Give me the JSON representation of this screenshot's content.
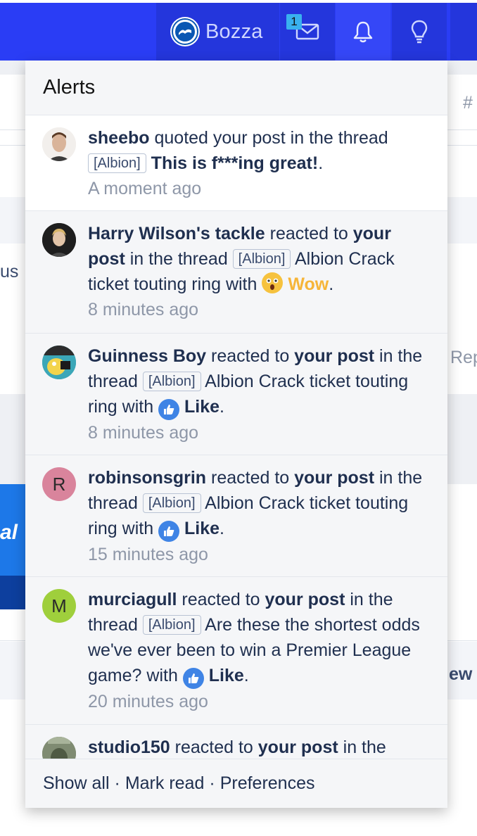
{
  "nav": {
    "username": "Bozza",
    "inbox_badge": "1"
  },
  "background": {
    "hash": "#",
    "us": "us",
    "rep": "Rep",
    "al": "al",
    "ew": "ew"
  },
  "alerts_panel": {
    "title": "Alerts",
    "items": [
      {
        "user": "sheebo",
        "action": " quoted your post in the thread ",
        "prefix": "[Albion]",
        "thread": "This is f***ing great!",
        "time": "A moment ago",
        "avatar_icon": "user-photo"
      },
      {
        "user": "Harry Wilson's tackle",
        "action1": " reacted to ",
        "your_post": "your post",
        "action2": " in the thread ",
        "prefix": "[Albion]",
        "thread": "Albion Crack ticket touting ring",
        "with": " with ",
        "reaction": "Wow",
        "time": "8 minutes ago",
        "avatar_icon": "user-photo"
      },
      {
        "user": "Guinness Boy",
        "action1": " reacted to ",
        "your_post": "your post",
        "action2": " in the thread ",
        "prefix": "[Albion]",
        "thread": "Albion Crack ticket touting ring",
        "with": " with ",
        "reaction": "Like",
        "time": "8 minutes ago",
        "avatar_icon": "user-photo"
      },
      {
        "user": "robinsonsgrin",
        "avatar_letter": "R",
        "action1": " reacted to ",
        "your_post": "your post",
        "action2": " in the thread ",
        "prefix": "[Albion]",
        "thread": "Albion Crack ticket touting ring",
        "with": " with ",
        "reaction": "Like",
        "time": "15 minutes ago"
      },
      {
        "user": "murciagull",
        "avatar_letter": "M",
        "action1": " reacted to ",
        "your_post": "your post",
        "action2": " in the thread ",
        "prefix": "[Albion]",
        "thread": "Are these the shortest odds we've ever been to win a Premier League game?",
        "with": " with ",
        "reaction": "Like",
        "time": "20 minutes ago"
      },
      {
        "user": "studio150",
        "action1": " reacted to ",
        "your_post": "your post",
        "action2": " in the",
        "avatar_icon": "user-photo"
      }
    ],
    "footer": {
      "show_all": "Show all",
      "mark_read": "Mark read",
      "preferences": "Preferences",
      "separator": "·"
    }
  },
  "colors": {
    "nav_bg": "#2a3df5",
    "avatar_r": "#d9849c",
    "avatar_m": "#9fcf3c",
    "like_blue": "#3f84e5",
    "wow_yellow": "#f6b539"
  }
}
